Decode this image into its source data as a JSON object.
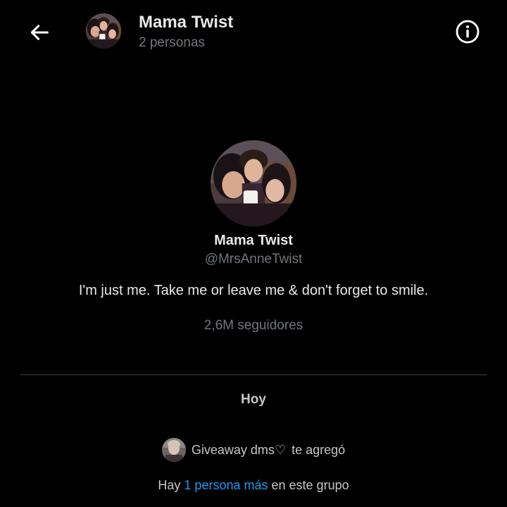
{
  "header": {
    "back_icon": "arrow-left-icon",
    "title": "Mama Twist",
    "subtitle": "2 personas",
    "info_icon": "info-circle-icon"
  },
  "profile": {
    "name": "Mama Twist",
    "handle": "@MrsAnneTwist",
    "bio": "I'm just me. Take me or leave me & don't forget to smile.",
    "followers": "2,6M seguidores"
  },
  "timeline": {
    "date_label": "Hoy",
    "event": {
      "actor": "Giveaway dms♡",
      "action": "te agregó"
    },
    "group_note": {
      "prefix": "Hay",
      "link": "1 persona más",
      "suffix": "en este grupo"
    }
  },
  "colors": {
    "background": "#000000",
    "primary_text": "#e7e9ea",
    "secondary_text": "#71767b",
    "link": "#1d9bf0"
  }
}
